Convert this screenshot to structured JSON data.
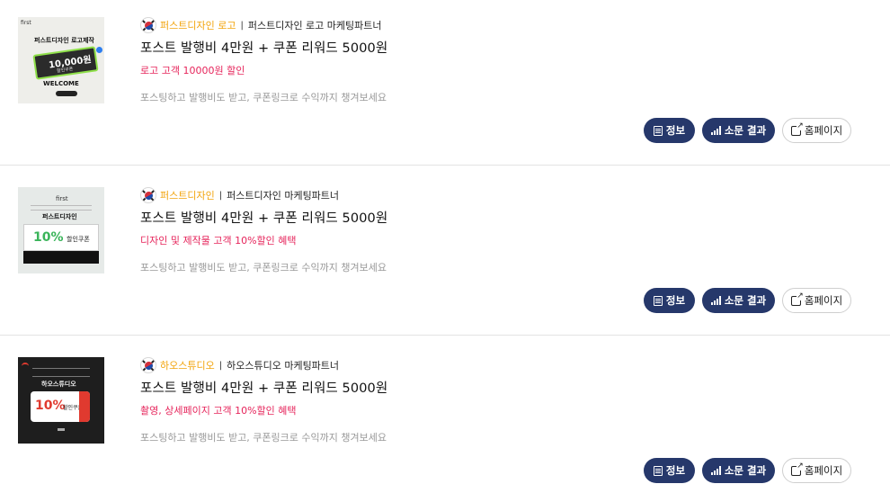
{
  "items": [
    {
      "thumb": {
        "logo": "first",
        "tag": "퍼스트디자인 로고제작",
        "big": "10,000원",
        "sub": "할인쿠폰",
        "footer": "WELCOME"
      },
      "brand": "퍼스트디자인 로고",
      "separator": "|",
      "partner": "퍼스트디자인 로고 마케팅파트너",
      "title": "포스트 발행비 4만원 + 쿠폰 리워드 5000원",
      "promo": "로고 고객 10000원 할인",
      "desc": "포스팅하고 발행비도 받고, 쿠폰링크로 수익까지 챙겨보세요",
      "buttons": {
        "info": "정보",
        "rumor": "소문 결과",
        "home": "홈페이지"
      }
    },
    {
      "thumb": {
        "logo": "first",
        "tag": "퍼스트디자인",
        "big": "10%",
        "sub": "할인쿠폰"
      },
      "brand": "퍼스트디자인",
      "separator": "|",
      "partner": "퍼스트디자인 마케팅파트너",
      "title": "포스트 발행비 4만원 + 쿠폰 리워드 5000원",
      "promo": "디자인 및 제작물 고객 10%할인 혜택",
      "desc": "포스팅하고 발행비도 받고, 쿠폰링크로 수익까지 챙겨보세요",
      "buttons": {
        "info": "정보",
        "rumor": "소문 결과",
        "home": "홈페이지"
      }
    },
    {
      "thumb": {
        "tag": "하오스튜디오",
        "big": "10%",
        "sub": "할인쿠폰"
      },
      "brand": "하오스튜디오",
      "separator": "|",
      "partner": "하오스튜디오 마케팅파트너",
      "title": "포스트 발행비 4만원 + 쿠폰 리워드 5000원",
      "promo": "촬영, 상세페이지 고객 10%할인 혜택",
      "desc": "포스팅하고 발행비도 받고, 쿠폰링크로 수익까지 챙겨보세요",
      "buttons": {
        "info": "정보",
        "rumor": "소문 결과",
        "home": "홈페이지"
      }
    }
  ],
  "colors": {
    "brand": "#f2a40b",
    "promo": "#e6245b",
    "button": "#26386b"
  }
}
